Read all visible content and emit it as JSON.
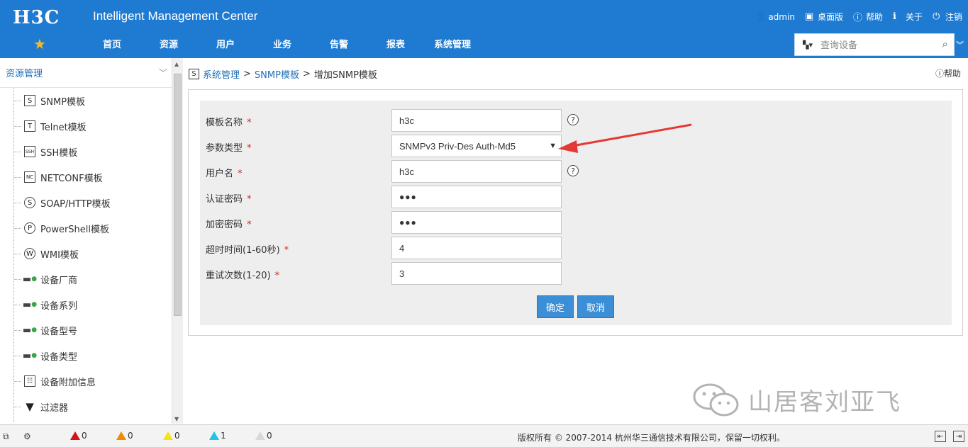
{
  "header": {
    "logo": "H3C",
    "app_title": "Intelligent Management Center",
    "user": "admin",
    "desktop": "桌面版",
    "help": "帮助",
    "about": "关于",
    "logout": "注销",
    "nav": [
      "首页",
      "资源",
      "用户",
      "业务",
      "告警",
      "报表",
      "系统管理"
    ],
    "search_placeholder": "查询设备"
  },
  "sidebar": {
    "title": "资源管理",
    "items": [
      {
        "label": "SNMP模板",
        "icon": "S"
      },
      {
        "label": "Telnet模板",
        "icon": "T"
      },
      {
        "label": "SSH模板",
        "icon": "SSH"
      },
      {
        "label": "NETCONF模板",
        "icon": "NC"
      },
      {
        "label": "SOAP/HTTP模板",
        "icon": "S"
      },
      {
        "label": "PowerShell模板",
        "icon": "P"
      },
      {
        "label": "WMI模板",
        "icon": "W"
      },
      {
        "label": "设备厂商",
        "icon": "vendor"
      },
      {
        "label": "设备系列",
        "icon": "series"
      },
      {
        "label": "设备型号",
        "icon": "model"
      },
      {
        "label": "设备类型",
        "icon": "type"
      },
      {
        "label": "设备附加信息",
        "icon": "info"
      },
      {
        "label": "过滤器",
        "icon": "filter"
      }
    ]
  },
  "breadcrumb": {
    "item1": "系统管理",
    "item2": "SNMP模板",
    "item3": "增加SNMP模板",
    "help": "帮助"
  },
  "form": {
    "template_name": {
      "label": "模板名称",
      "value": "h3c"
    },
    "param_type": {
      "label": "参数类型",
      "value": "SNMPv3 Priv-Des Auth-Md5"
    },
    "username": {
      "label": "用户名",
      "value": "h3c"
    },
    "auth_password": {
      "label": "认证密码",
      "value": "●●●"
    },
    "encrypt_password": {
      "label": "加密密码",
      "value": "●●●"
    },
    "timeout": {
      "label": "超时时间(1-60秒)",
      "value": "4"
    },
    "retries": {
      "label": "重试次数(1-20)",
      "value": "3"
    },
    "required_mark": "*",
    "ok_label": "确定",
    "cancel_label": "取消"
  },
  "watermark": {
    "text": "山居客刘亚飞"
  },
  "statusbar": {
    "alarm_critical": "0",
    "alarm_major": "0",
    "alarm_minor": "0",
    "alarm_warning": "1",
    "alarm_info": "0",
    "copyright": "版权所有 © 2007-2014 杭州华三通信技术有限公司，保留一切权利。"
  },
  "colors": {
    "header_bg": "#1f7bd1",
    "link": "#1f6fb8",
    "button": "#3c8fd6",
    "arrow": "#e53935"
  }
}
